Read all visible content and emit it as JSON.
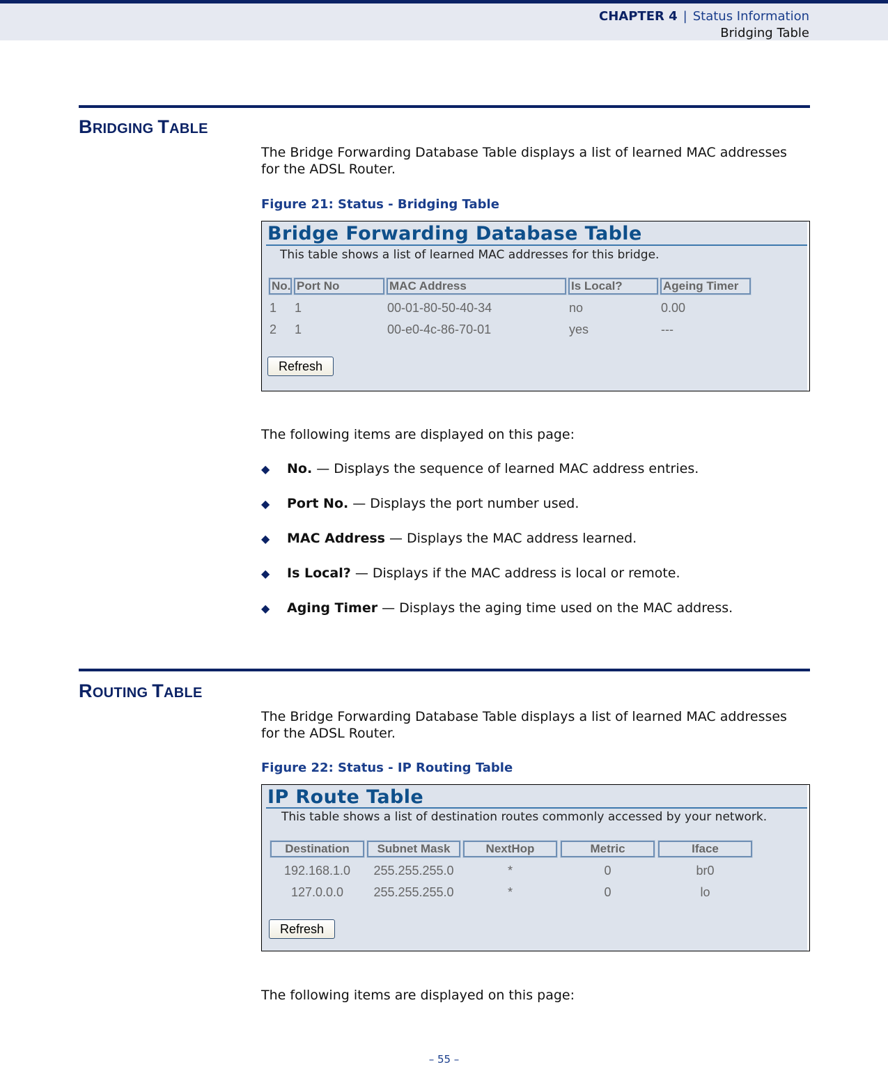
{
  "header": {
    "chapter": "CHAPTER 4",
    "separator": "|",
    "section": "Status Information",
    "subsection": "Bridging Table"
  },
  "bridging": {
    "title_first": "B",
    "title_rest1": "RIDGING ",
    "title_second": "T",
    "title_rest2": "ABLE",
    "intro": "The Bridge Forwarding Database Table displays a list of learned MAC addresses for the ADSL Router.",
    "figure_caption": "Figure 21:  Status - Bridging Table",
    "screenshot": {
      "title": "Bridge Forwarding Database Table",
      "subtitle": "This table shows a list of learned MAC addresses for this bridge.",
      "columns": [
        "No.",
        "Port No",
        "MAC Address",
        "Is Local?",
        "Ageing Timer"
      ],
      "rows": [
        [
          "1",
          "1",
          "00-01-80-50-40-34",
          "no",
          "0.00"
        ],
        [
          "2",
          "1",
          "00-e0-4c-86-70-01",
          "yes",
          "---"
        ]
      ],
      "refresh_label": "Refresh"
    },
    "items_intro": "The following items are displayed on this page:",
    "items": [
      {
        "term": "No.",
        "desc": " — Displays the sequence of learned MAC address entries."
      },
      {
        "term": "Port No.",
        "desc": " — Displays the port number used."
      },
      {
        "term": "MAC Address",
        "desc": " — Displays the MAC address learned."
      },
      {
        "term": "Is Local?",
        "desc": " — Displays if the MAC address is local or remote."
      },
      {
        "term": "Aging Timer",
        "desc": " — Displays the aging time used on the MAC address."
      }
    ]
  },
  "routing": {
    "title_first": "R",
    "title_rest1": "OUTING ",
    "title_second": "T",
    "title_rest2": "ABLE",
    "intro": "The Bridge Forwarding Database Table displays a list of learned MAC addresses for the ADSL Router.",
    "figure_caption": "Figure 22:  Status - IP Routing Table",
    "screenshot": {
      "title": "IP Route Table",
      "subtitle": "This table shows a list of destination routes commonly accessed by your network.",
      "columns": [
        "Destination",
        "Subnet Mask",
        "NextHop",
        "Metric",
        "Iface"
      ],
      "rows": [
        [
          "192.168.1.0",
          "255.255.255.0",
          "*",
          "0",
          "br0"
        ],
        [
          "127.0.0.0",
          "255.255.255.0",
          "*",
          "0",
          "lo"
        ]
      ],
      "refresh_label": "Refresh"
    },
    "items_intro": "The following items are displayed on this page:"
  },
  "footer": {
    "page_number": "–  55  –"
  },
  "icons": {
    "bullet": "◆"
  },
  "colors": {
    "brand_navy": "#0b2265",
    "caption_blue": "#1a3e8c",
    "screenshot_bg": "#dde3ec",
    "screenshot_title": "#0e4f8a"
  }
}
